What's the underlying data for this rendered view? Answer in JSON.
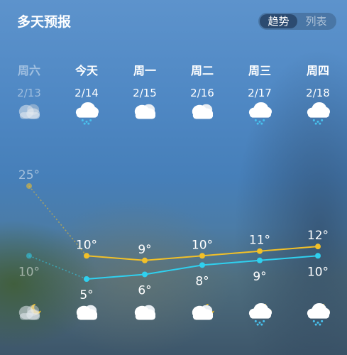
{
  "header": {
    "title": "多天预报",
    "tabs": [
      {
        "label": "趋势",
        "active": true
      },
      {
        "label": "列表",
        "active": false
      }
    ]
  },
  "forecast": {
    "days": [
      {
        "day": "周六",
        "date": "2/13",
        "past": true,
        "top_icon": "cloudy-icon",
        "bottom_icon": "night-cloudy-icon"
      },
      {
        "day": "今天",
        "date": "2/14",
        "past": false,
        "top_icon": "snow-cloud-icon",
        "bottom_icon": "cloudy-icon"
      },
      {
        "day": "周一",
        "date": "2/15",
        "past": false,
        "top_icon": "cloudy-icon",
        "bottom_icon": "cloudy-icon"
      },
      {
        "day": "周二",
        "date": "2/16",
        "past": false,
        "top_icon": "cloudy-icon",
        "bottom_icon": "night-cloudy-icon"
      },
      {
        "day": "周三",
        "date": "2/17",
        "past": false,
        "top_icon": "snow-cloud-icon",
        "bottom_icon": "night-snow-icon"
      },
      {
        "day": "周四",
        "date": "2/18",
        "past": false,
        "top_icon": "snow-cloud-icon",
        "bottom_icon": "night-snow-icon"
      }
    ]
  },
  "chart_data": {
    "type": "line",
    "x": [
      "周六",
      "今天",
      "周一",
      "周二",
      "周三",
      "周四"
    ],
    "series": [
      {
        "values": [
          25,
          10,
          9,
          10,
          11,
          12
        ],
        "color": "#f2c028",
        "labels": [
          "25°",
          "10°",
          "9°",
          "10°",
          "11°",
          "12°"
        ]
      },
      {
        "values": [
          10,
          5,
          6,
          8,
          9,
          10
        ],
        "color": "#2fd0ef",
        "labels": [
          "10°",
          "5°",
          "6°",
          "8°",
          "9°",
          "10°"
        ]
      }
    ],
    "past_count": 1
  }
}
